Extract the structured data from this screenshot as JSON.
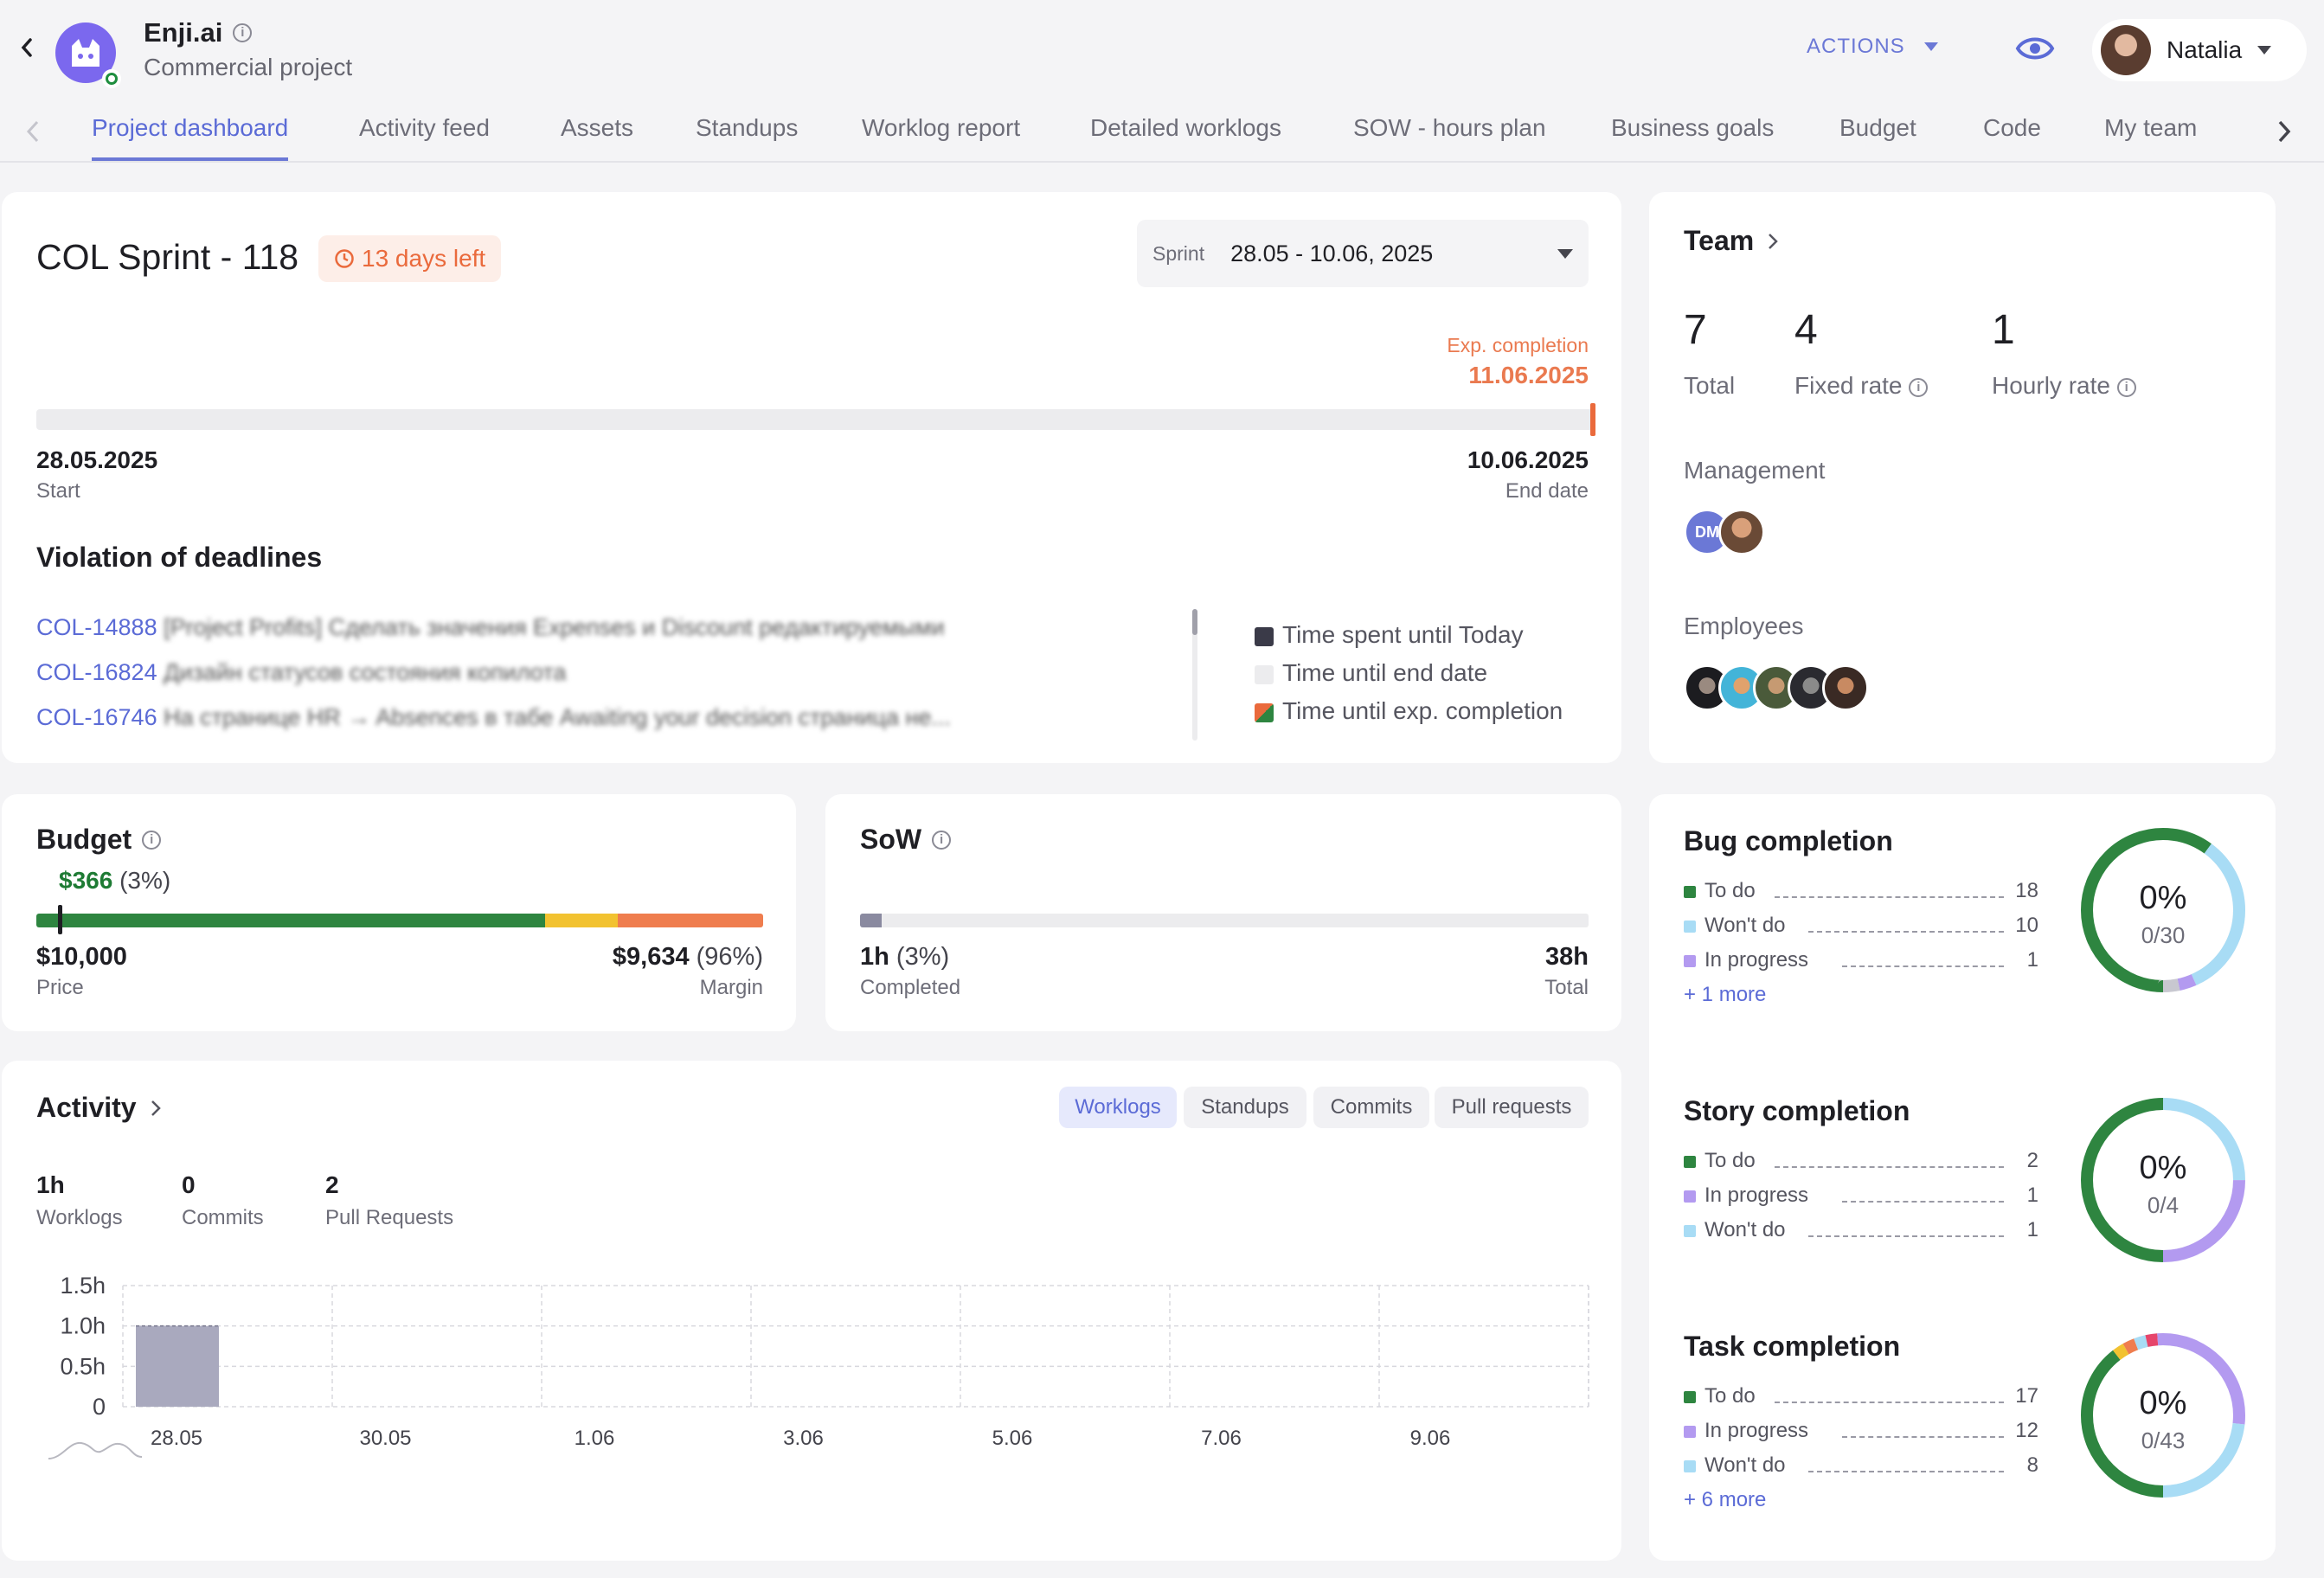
{
  "header": {
    "app_name": "Enji.ai",
    "app_subtitle": "Commercial project",
    "actions_label": "ACTIONS",
    "user_name": "Natalia",
    "brand_color": "#7b68ee"
  },
  "tabs": [
    {
      "label": "Project dashboard",
      "active": true
    },
    {
      "label": "Activity feed"
    },
    {
      "label": "Assets"
    },
    {
      "label": "Standups"
    },
    {
      "label": "Worklog report"
    },
    {
      "label": "Detailed worklogs"
    },
    {
      "label": "SOW - hours plan"
    },
    {
      "label": "Business goals"
    },
    {
      "label": "Budget"
    },
    {
      "label": "Code"
    },
    {
      "label": "My team"
    }
  ],
  "sprint": {
    "title": "COL Sprint - 118",
    "days_left": "13 days left",
    "selector_label": "Sprint",
    "selector_value": "28.05 - 10.06, 2025",
    "exp_completion_label": "Exp. completion",
    "exp_completion_date": "11.06.2025",
    "start_date": "28.05.2025",
    "start_label": "Start",
    "end_date": "10.06.2025",
    "end_label": "End date",
    "violations_title": "Violation of deadlines",
    "violations": [
      {
        "key": "COL-14888",
        "text": "[Project Profits] Сделать значения Expenses и Discount редактируемыми"
      },
      {
        "key": "COL-16824",
        "text": "Дизайн статусов состояния копилота"
      },
      {
        "key": "COL-16746",
        "text": "На странице HR → Absences в табе Awaiting your decision страница не..."
      }
    ],
    "legend": [
      "Time spent until Today",
      "Time until end date",
      "Time until exp. completion"
    ]
  },
  "team": {
    "title": "Team",
    "total": "7",
    "total_label": "Total",
    "fixed": "4",
    "fixed_label": "Fixed rate",
    "hourly": "1",
    "hourly_label": "Hourly rate",
    "management_label": "Management",
    "management_initials": "DM",
    "employees_label": "Employees"
  },
  "budget": {
    "title": "Budget",
    "spent": "$366",
    "spent_pct": "(3%)",
    "price": "$10,000",
    "price_label": "Price",
    "margin": "$9,634",
    "margin_pct": "(96%)",
    "margin_label": "Margin",
    "spent_fraction": 0.03,
    "segments": [
      {
        "color": "#2e8540",
        "fraction": 0.7
      },
      {
        "color": "#f2c230",
        "fraction": 0.1
      },
      {
        "color": "#ef7d4e",
        "fraction": 0.2
      }
    ]
  },
  "sow": {
    "title": "SoW",
    "completed": "1h",
    "completed_pct": "(3%)",
    "completed_label": "Completed",
    "total": "38h",
    "total_label": "Total",
    "fraction": 0.03
  },
  "activity": {
    "title": "Activity",
    "filters": [
      "Worklogs",
      "Standups",
      "Commits",
      "Pull requests"
    ],
    "stats": [
      {
        "value": "1h",
        "label": "Worklogs"
      },
      {
        "value": "0",
        "label": "Commits"
      },
      {
        "value": "2",
        "label": "Pull Requests"
      }
    ]
  },
  "chart_data": {
    "type": "bar",
    "categories": [
      "28.05",
      "30.05",
      "1.06",
      "3.06",
      "5.06",
      "7.06",
      "9.06"
    ],
    "values": [
      1.0,
      0,
      0,
      0,
      0,
      0,
      0
    ],
    "y_ticks": [
      "0",
      "0.5h",
      "1.0h",
      "1.5h"
    ],
    "ylim": [
      0,
      1.5
    ],
    "grid": true,
    "bar_color": "#a9a9be"
  },
  "completions": [
    {
      "title": "Bug completion",
      "percent": "0%",
      "ratio": "0/30",
      "rows": [
        {
          "label": "To do",
          "count": "18",
          "color": "#2e8540"
        },
        {
          "label": "Won't do",
          "count": "10",
          "color": "#a8dcf5"
        },
        {
          "label": "In progress",
          "count": "1",
          "color": "#b39af0"
        }
      ],
      "more": "+ 1 more",
      "ring": [
        {
          "color": "#2e8540",
          "value": 18
        },
        {
          "color": "#a8dcf5",
          "value": 10
        },
        {
          "color": "#b39af0",
          "value": 1
        },
        {
          "color": "#c8c8d0",
          "value": 1
        }
      ]
    },
    {
      "title": "Story completion",
      "percent": "0%",
      "ratio": "0/4",
      "rows": [
        {
          "label": "To do",
          "count": "2",
          "color": "#2e8540"
        },
        {
          "label": "In progress",
          "count": "1",
          "color": "#b39af0"
        },
        {
          "label": "Won't do",
          "count": "1",
          "color": "#a8dcf5"
        }
      ],
      "more": "",
      "ring": [
        {
          "color": "#2e8540",
          "value": 2
        },
        {
          "color": "#a8dcf5",
          "value": 1
        },
        {
          "color": "#b39af0",
          "value": 1
        }
      ]
    },
    {
      "title": "Task completion",
      "percent": "0%",
      "ratio": "0/43",
      "rows": [
        {
          "label": "To do",
          "count": "17",
          "color": "#2e8540"
        },
        {
          "label": "In progress",
          "count": "12",
          "color": "#b39af0"
        },
        {
          "label": "Won't do",
          "count": "8",
          "color": "#a8dcf5"
        }
      ],
      "more": "+ 6 more",
      "ring": [
        {
          "color": "#2e8540",
          "value": 17
        },
        {
          "color": "#f2c230",
          "value": 1
        },
        {
          "color": "#ef7d4e",
          "value": 1
        },
        {
          "color": "#a8dcf5",
          "value": 1
        },
        {
          "color": "#e6456b",
          "value": 1
        },
        {
          "color": "#b39af0",
          "value": 12
        },
        {
          "color": "#a8dcf5",
          "value": 10
        }
      ]
    }
  ]
}
